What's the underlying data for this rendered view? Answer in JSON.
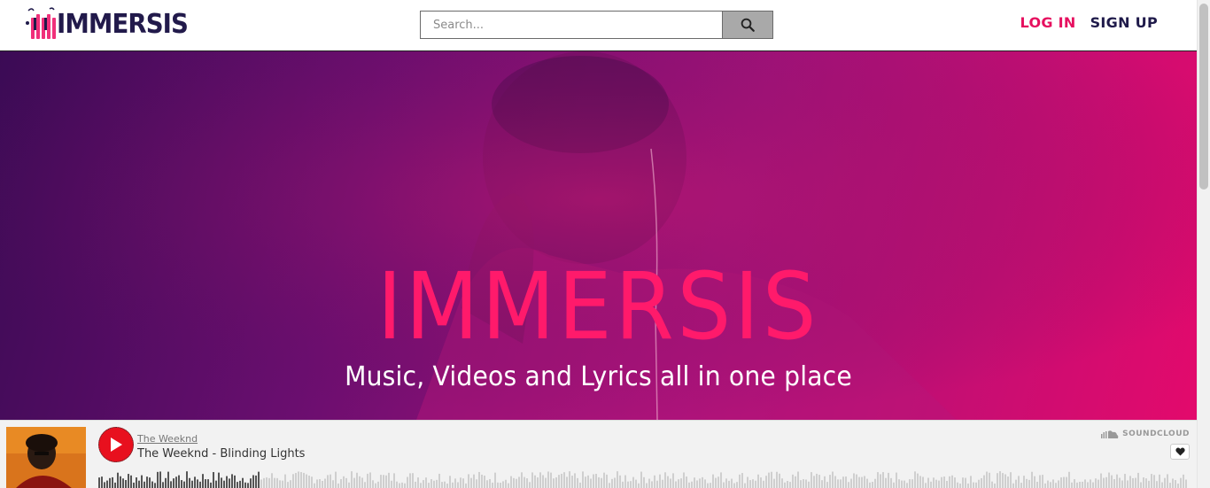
{
  "header": {
    "brand": "IMMERSIS",
    "search_placeholder": "Search...",
    "login_label": "LOG IN",
    "signup_label": "SIGN UP"
  },
  "hero": {
    "title": "IMMERSIS",
    "subtitle": "Music, Videos and Lyrics all in one place"
  },
  "player": {
    "artist": "The Weeknd",
    "track_title": "The Weeknd - Blinding Lights",
    "brand": "SOUNDCLOUD",
    "progress": 0.15
  },
  "colors": {
    "accent_pink": "#e6105f",
    "navy": "#1f1a4a",
    "play_red": "#e8101e"
  },
  "icons": [
    "logo-icon",
    "search-icon",
    "play-icon",
    "soundcloud-icon",
    "heart-icon"
  ]
}
